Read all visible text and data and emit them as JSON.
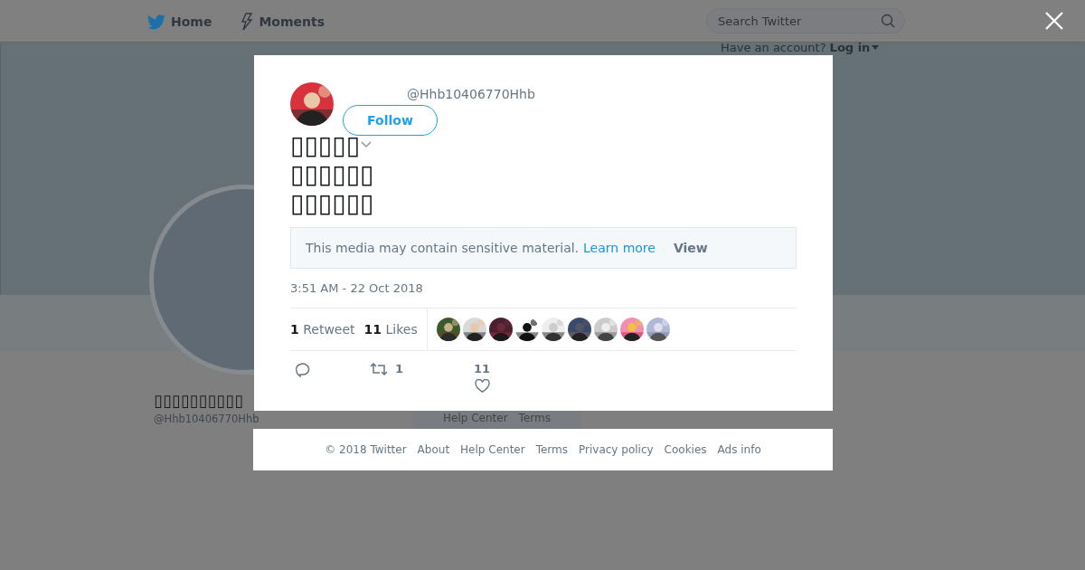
{
  "header": {
    "nav": [
      {
        "kind": "bird",
        "label": "Home"
      },
      {
        "kind": "bolt",
        "label": "Moments"
      }
    ],
    "search": {
      "placeholder": "Search Twitter"
    },
    "account": {
      "prompt": "Have an account?",
      "login": "Log in"
    }
  },
  "profile": {
    "name": "▯▯▯▯▯▯▯▯▯▯",
    "handle": "@Hhb10406770Hhb"
  },
  "side_card": {
    "links": [
      "Help Center",
      "Terms"
    ]
  },
  "tweet": {
    "handle": "@Hhb10406770Hhb",
    "follow": "Follow",
    "text_lines": [
      "▯▯▯▯▯",
      "▯▯▯▯▯▯",
      "▯▯▯▯▯▯"
    ],
    "sensitive": {
      "message": "This media may contain sensitive material.",
      "link": "Learn more",
      "action": "View"
    },
    "timestamp": "3:51 AM - 22 Oct 2018",
    "stats": [
      {
        "count": "1",
        "label": "Retweet"
      },
      {
        "count": "11",
        "label": "Likes"
      }
    ],
    "actions": [
      {
        "kind": "reply"
      },
      {
        "kind": "retweet",
        "count": "1"
      },
      {
        "kind": "like",
        "count": "11"
      }
    ]
  },
  "footer": [
    "© 2018 Twitter",
    "About",
    "Help Center",
    "Terms",
    "Privacy policy",
    "Cookies",
    "Ads info"
  ]
}
